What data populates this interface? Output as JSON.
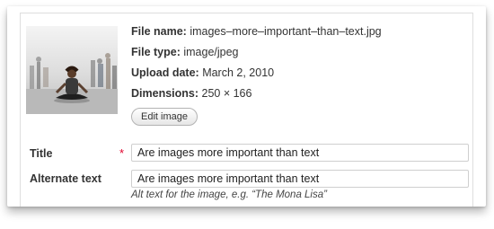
{
  "file_info": {
    "name_label": "File name:",
    "name_value": "images–more–important–than–text.jpg",
    "type_label": "File type:",
    "type_value": "image/jpeg",
    "upload_label": "Upload date:",
    "upload_value": "March 2, 2010",
    "dims_label": "Dimensions:",
    "dims_value": "250 × 166",
    "edit_button": "Edit image"
  },
  "form": {
    "title_label": "Title",
    "required_mark": "*",
    "title_value": "Are images more important than text",
    "alt_label": "Alternate text",
    "alt_value": "Are images more important than text",
    "alt_help": "Alt text for the image, e.g. “The Mona Lisa”"
  },
  "colors": {
    "required": "#e0002a",
    "border": "#cfcfcf"
  }
}
